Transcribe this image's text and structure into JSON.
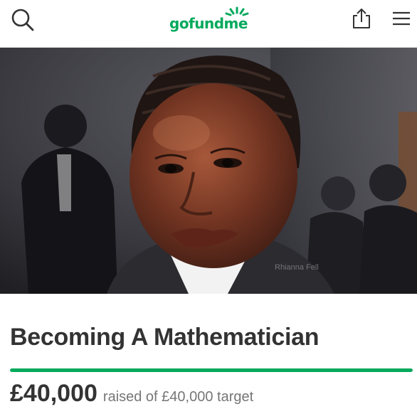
{
  "header": {
    "logo_text": "gofundme",
    "icons": [
      "search-icon",
      "share-icon",
      "hamburger-menu-icon"
    ]
  },
  "hero": {
    "alt": "Campaign photo",
    "watermark": "Rhianna Fell"
  },
  "campaign": {
    "title": "Becoming A Mathematician",
    "raised_amount": "£40,000",
    "raised_text": "raised of £40,000 target",
    "progress": 1.0
  },
  "colors": {
    "brand_green": "#02a95c",
    "title_text": "#333333",
    "secondary_text": "#767676"
  }
}
